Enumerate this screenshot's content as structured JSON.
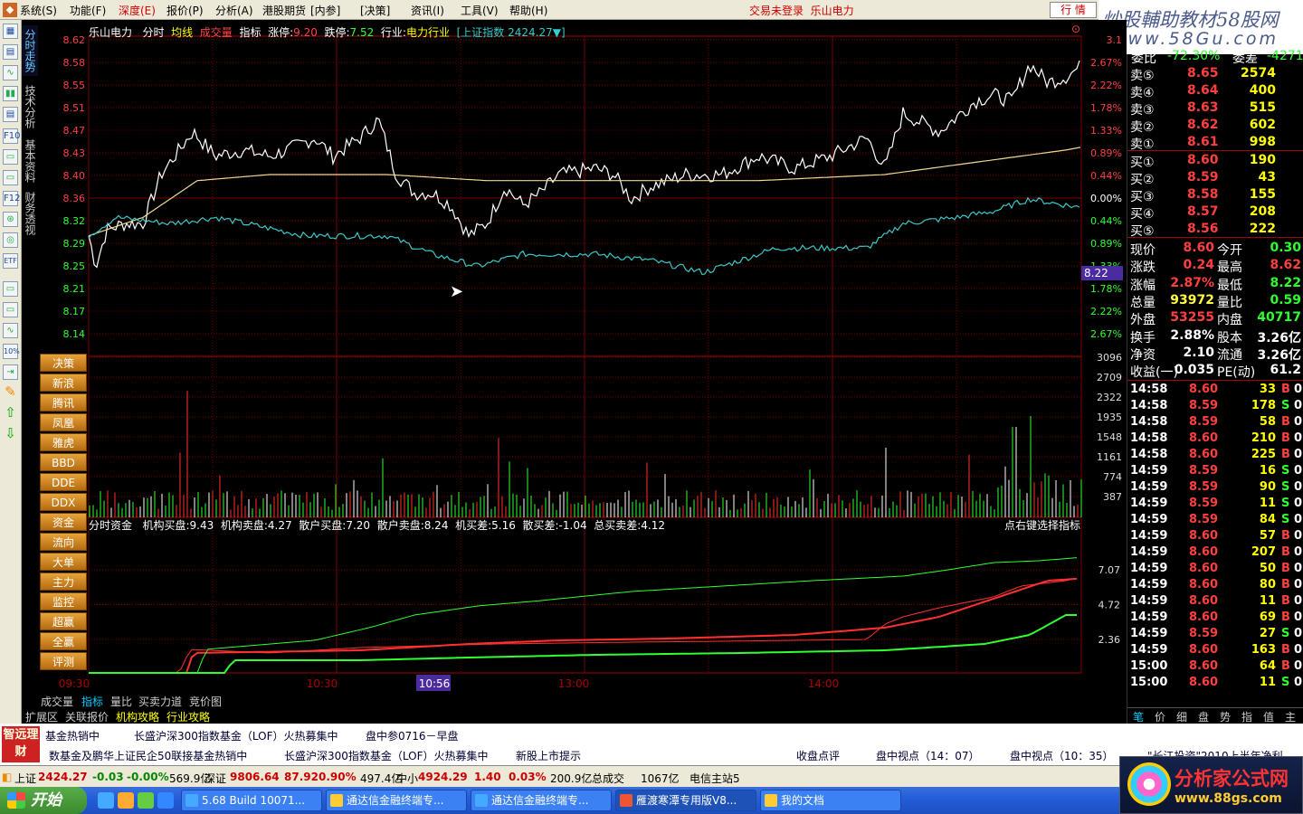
{
  "menu": {
    "items": [
      "系统(S)",
      "功能(F)",
      "深度(E)",
      "报价(P)",
      "分析(A)",
      "港股期货",
      "[内参]",
      "[决策]",
      "资讯(I)",
      "工具(V)",
      "帮助(H)"
    ],
    "login_status": "交易未登录",
    "stock_name": "乐山电力",
    "quote_button": "行 情"
  },
  "watermark": {
    "line1": "炒股輔助教材58股网",
    "line2": "www.58Gu.com"
  },
  "side_tabs": [
    "分时走势",
    "技术分析",
    "基本资料",
    "财务透视"
  ],
  "left_toolbar": [
    "▦",
    "▤",
    "∿",
    "▮▮",
    "▤",
    "F10",
    "▭",
    "▭",
    "F12",
    "⊛",
    "◎",
    "ETF",
    "▭",
    "▭",
    "∿",
    "10%",
    "⇥",
    "✎",
    "⇧",
    "⇩"
  ],
  "chart_header": {
    "name": "乐山电力",
    "mode": "分时",
    "avg_line": "均线",
    "vol_label": "成交量",
    "indicator": "指标",
    "limit_up_label": "涨停:",
    "limit_up": "9.20",
    "limit_down_label": "跌停:",
    "limit_down": "7.52",
    "industry_label": "行业:",
    "industry": "电力行业",
    "index_label": "[上证指数",
    "index_value": "2424.27▼]"
  },
  "axes": {
    "price_ticks": [
      "8.62",
      "8.58",
      "8.55",
      "8.51",
      "8.47",
      "8.43",
      "8.40",
      "8.36",
      "8.32",
      "8.29",
      "8.25",
      "8.21",
      "8.17",
      "8.14"
    ],
    "pct_ticks": [
      "3.1",
      "2.67%",
      "2.22%",
      "1.78%",
      "1.33%",
      "0.89%",
      "0.44%",
      "0.00%",
      "0.44%",
      "0.89%",
      "1.33%",
      "1.78%",
      "2.22%",
      "2.67%"
    ],
    "cursor_price": "8.22",
    "vol_ticks": [
      "3096",
      "2709",
      "2322",
      "1935",
      "1548",
      "1161",
      "774",
      "387"
    ],
    "fund_ticks": [
      "7.07",
      "4.72",
      "2.36"
    ],
    "time_labels": [
      "09:30",
      "10:30",
      "10:56",
      "13:00",
      "14:00"
    ]
  },
  "side_buttons": [
    "决策",
    "新浪",
    "腾讯",
    "凤凰",
    "雅虎",
    "BBD",
    "DDE",
    "DDX",
    "资金",
    "流向",
    "大单",
    "主力",
    "监控",
    "超赢",
    "全赢",
    "评测"
  ],
  "fund_header": {
    "title": "分时资金",
    "items": [
      "机构买盘:9.43",
      "机构卖盘:4.27",
      "散户买盘:7.20",
      "散户卖盘:8.24",
      "机买差:5.16",
      "散买差:-1.04",
      "总买卖差:4.12"
    ],
    "hint": "点右键选择指标"
  },
  "chart_data": {
    "type": "line",
    "series": [
      {
        "name": "价格",
        "color": "#ffffff"
      },
      {
        "name": "均线",
        "color": "#f0d890"
      },
      {
        "name": "上证指数",
        "color": "#3cc8c8"
      },
      {
        "name": "机构买盘",
        "color": "#ff3030"
      },
      {
        "name": "散户买盘",
        "color": "#30ff30"
      }
    ],
    "price_range": [
      8.14,
      8.62
    ],
    "open_price": 8.36,
    "close_price": 8.6
  },
  "bottom_tabs": {
    "row1": [
      "成交量",
      "指标",
      "量比",
      "买卖力道",
      "竞价图"
    ],
    "row2": [
      "扩展区",
      "关联报价",
      "机构攻略",
      "行业攻略"
    ]
  },
  "right_panel": {
    "top_partial": {
      "label1": "委比",
      "val1": "-72.30%",
      "label2": "委差",
      "val2": "-4271"
    },
    "asks": [
      {
        "label": "卖⑤",
        "price": "8.65",
        "vol": "2574"
      },
      {
        "label": "卖④",
        "price": "8.64",
        "vol": "400"
      },
      {
        "label": "卖③",
        "price": "8.63",
        "vol": "515"
      },
      {
        "label": "卖②",
        "price": "8.62",
        "vol": "602"
      },
      {
        "label": "卖①",
        "price": "8.61",
        "vol": "998"
      }
    ],
    "bids": [
      {
        "label": "买①",
        "price": "8.60",
        "vol": "190"
      },
      {
        "label": "买②",
        "price": "8.59",
        "vol": "43"
      },
      {
        "label": "买③",
        "price": "8.58",
        "vol": "155"
      },
      {
        "label": "买④",
        "price": "8.57",
        "vol": "208"
      },
      {
        "label": "买⑤",
        "price": "8.56",
        "vol": "222"
      }
    ],
    "stats": [
      {
        "l1": "现价",
        "v1": "8.60",
        "c1": "#ff4040",
        "l2": "今开",
        "v2": "0.30",
        "c2": "#30ff30"
      },
      {
        "l1": "涨跌",
        "v1": "0.24",
        "c1": "#ff4040",
        "l2": "最高",
        "v2": "8.62",
        "c2": "#ff4040"
      },
      {
        "l1": "涨幅",
        "v1": "2.87%",
        "c1": "#ff4040",
        "l2": "最低",
        "v2": "8.22",
        "c2": "#30ff30"
      },
      {
        "l1": "总量",
        "v1": "93972",
        "c1": "#ffff40",
        "l2": "量比",
        "v2": "0.59",
        "c2": "#30ff30"
      },
      {
        "l1": "外盘",
        "v1": "53255",
        "c1": "#ff4040",
        "l2": "内盘",
        "v2": "40717",
        "c2": "#30ff30"
      },
      {
        "l1": "换手",
        "v1": "2.88%",
        "c1": "#ffffff",
        "l2": "股本",
        "v2": "3.26亿",
        "c2": "#ffffff"
      },
      {
        "l1": "净资",
        "v1": "2.10",
        "c1": "#ffffff",
        "l2": "流通",
        "v2": "3.26亿",
        "c2": "#ffffff"
      },
      {
        "l1": "收益(一)",
        "v1": "0.035",
        "c1": "#ffffff",
        "l2": "PE(动)",
        "v2": "61.2",
        "c2": "#ffffff"
      }
    ],
    "ticks": [
      {
        "time": "14:58",
        "price": "8.60",
        "pc": "#ff4040",
        "vol": "33",
        "bs": "B",
        "n": "0"
      },
      {
        "time": "14:58",
        "price": "8.59",
        "pc": "#ff4040",
        "vol": "178",
        "bs": "S",
        "n": "0"
      },
      {
        "time": "14:58",
        "price": "8.59",
        "pc": "#ff4040",
        "vol": "58",
        "bs": "B",
        "n": "0"
      },
      {
        "time": "14:58",
        "price": "8.60",
        "pc": "#ff4040",
        "vol": "210",
        "bs": "B",
        "n": "0"
      },
      {
        "time": "14:58",
        "price": "8.60",
        "pc": "#ff4040",
        "vol": "225",
        "bs": "B",
        "n": "0"
      },
      {
        "time": "14:59",
        "price": "8.59",
        "pc": "#ff4040",
        "vol": "16",
        "bs": "S",
        "n": "0"
      },
      {
        "time": "14:59",
        "price": "8.59",
        "pc": "#ff4040",
        "vol": "90",
        "bs": "S",
        "n": "0"
      },
      {
        "time": "14:59",
        "price": "8.59",
        "pc": "#ff4040",
        "vol": "11",
        "bs": "S",
        "n": "0"
      },
      {
        "time": "14:59",
        "price": "8.59",
        "pc": "#ff4040",
        "vol": "84",
        "bs": "S",
        "n": "0"
      },
      {
        "time": "14:59",
        "price": "8.60",
        "pc": "#ff4040",
        "vol": "57",
        "bs": "B",
        "n": "0"
      },
      {
        "time": "14:59",
        "price": "8.60",
        "pc": "#ff4040",
        "vol": "207",
        "bs": "B",
        "n": "0"
      },
      {
        "time": "14:59",
        "price": "8.60",
        "pc": "#ff4040",
        "vol": "50",
        "bs": "B",
        "n": "0"
      },
      {
        "time": "14:59",
        "price": "8.60",
        "pc": "#ff4040",
        "vol": "80",
        "bs": "B",
        "n": "0"
      },
      {
        "time": "14:59",
        "price": "8.60",
        "pc": "#ff4040",
        "vol": "11",
        "bs": "B",
        "n": "0"
      },
      {
        "time": "14:59",
        "price": "8.60",
        "pc": "#ff4040",
        "vol": "69",
        "bs": "B",
        "n": "0"
      },
      {
        "time": "14:59",
        "price": "8.59",
        "pc": "#ff4040",
        "vol": "27",
        "bs": "S",
        "n": "0"
      },
      {
        "time": "14:59",
        "price": "8.60",
        "pc": "#ff4040",
        "vol": "163",
        "bs": "B",
        "n": "0"
      },
      {
        "time": "15:00",
        "price": "8.60",
        "pc": "#ff4040",
        "vol": "64",
        "bs": "B",
        "n": "0"
      },
      {
        "time": "15:00",
        "price": "8.60",
        "pc": "#ff4040",
        "vol": "11",
        "bs": "S",
        "n": "0"
      }
    ],
    "tabs": [
      "笔",
      "价",
      "细",
      "盘",
      "势",
      "指",
      "值",
      "主"
    ]
  },
  "news": {
    "logo": "智远理财",
    "row1": [
      "基金热销中",
      "长盛沪深300指数基金（LOF）火热募集中",
      "盘中参0716－早盘"
    ],
    "row2": [
      "数基金及鹏华上证民企50联接基金热销中",
      "长盛沪深300指数基金（LOF）火热募集中",
      "新股上市提示",
      "收盘点评",
      "盘中视点（14：07）",
      "盘中视点（10：35）",
      "\"长江投资\"2010上半年净利"
    ]
  },
  "status_bar": {
    "sh_label": "上证",
    "sh_val": "2424.27",
    "sh_chg": "-0.03",
    "sh_pct": "-0.00%",
    "sh_amt": "569.9亿",
    "sz_label": "深证",
    "sz_val": "9806.64",
    "sz_chg": "87.92",
    "sz_pct": "0.90%",
    "sz_amt": "497.4亿",
    "zx_label": "中小",
    "zx_val": "4924.29",
    "zx_chg": "1.40",
    "zx_pct": "0.03%",
    "zx_amt": "200.9亿",
    "total_label": "总成交",
    "total_amt": "1067亿",
    "server": "电信主站5"
  },
  "taskbar": {
    "start": "开始",
    "tasks": [
      "5.68 Build 10071...",
      "通达信金融终端专...",
      "通达信金融终端专...",
      "雁渡寒潭专用版V8...",
      "我的文档"
    ]
  },
  "brand": {
    "name": "分析家公式网",
    "url": "www.88gs.com"
  }
}
